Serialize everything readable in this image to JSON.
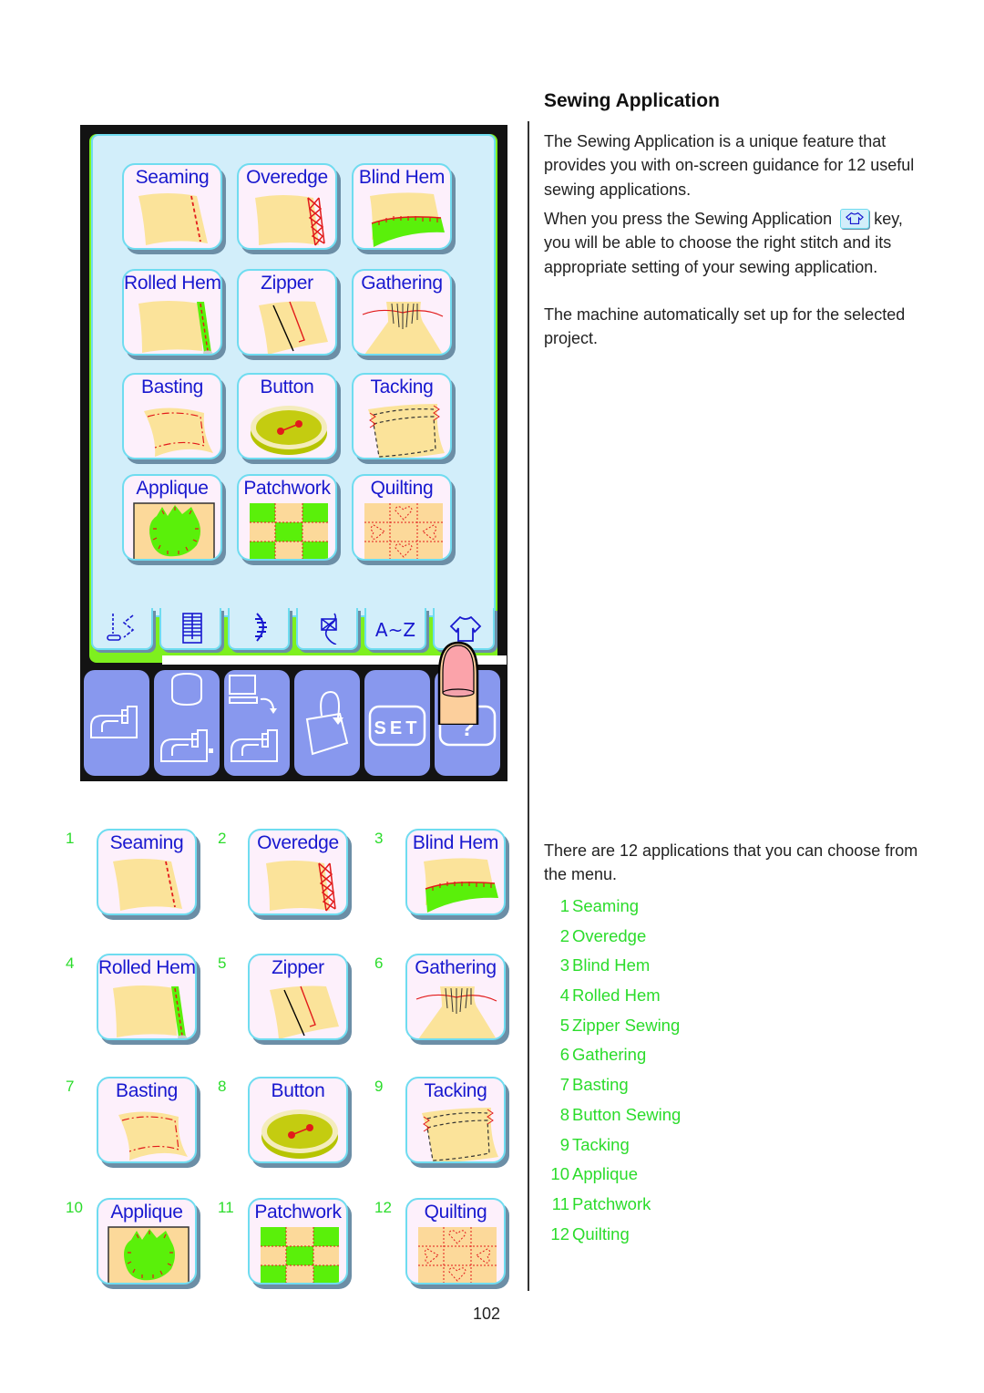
{
  "screen": {
    "tiles": [
      {
        "id": "seaming",
        "label": "Seaming"
      },
      {
        "id": "overedge",
        "label": "Overedge"
      },
      {
        "id": "blind-hem",
        "label": "Blind Hem"
      },
      {
        "id": "rolled-hem",
        "label": "Rolled Hem"
      },
      {
        "id": "zipper",
        "label": "Zipper"
      },
      {
        "id": "gathering",
        "label": "Gathering"
      },
      {
        "id": "basting",
        "label": "Basting"
      },
      {
        "id": "button",
        "label": "Button"
      },
      {
        "id": "tacking",
        "label": "Tacking"
      },
      {
        "id": "applique",
        "label": "Applique"
      },
      {
        "id": "patchwork",
        "label": "Patchwork"
      },
      {
        "id": "quilting",
        "label": "Quilting"
      }
    ],
    "tabs": [
      {
        "icon": "utility-stitch-icon"
      },
      {
        "icon": "buttonhole-icon"
      },
      {
        "icon": "decorative-stitch-icon"
      },
      {
        "icon": "cross-stitch-icon"
      },
      {
        "icon": "alphabet-icon",
        "label": "A~Z"
      },
      {
        "icon": "sewing-application-icon"
      }
    ],
    "keys": [
      {
        "icon": "sewing-machine-icon"
      },
      {
        "icon": "embroidery-unit-icon"
      },
      {
        "icon": "pc-connection-icon"
      },
      {
        "icon": "memory-folder-icon"
      },
      {
        "icon": "set-icon",
        "label": "SET"
      },
      {
        "icon": "help-icon",
        "label": "?"
      }
    ]
  },
  "article": {
    "title": "Sewing Application",
    "intro": "The Sewing Application is a unique feature that provides you with on-screen guidance for 12 useful sewing applications.",
    "press_before": "When you press the Sewing Application",
    "press_after": "key, you will be able to choose the right stitch and its appropriate setting of your sewing application.",
    "auto_setup": "The machine automatically set up for the selected project.",
    "choose": "There are 12 applications that you can choose from the menu.",
    "applications": [
      {
        "num": "1",
        "name": "Seaming"
      },
      {
        "num": "2",
        "name": "Overedge"
      },
      {
        "num": "3",
        "name": "Blind Hem"
      },
      {
        "num": "4",
        "name": "Rolled Hem"
      },
      {
        "num": "5",
        "name": "Zipper Sewing"
      },
      {
        "num": "6",
        "name": "Gathering"
      },
      {
        "num": "7",
        "name": "Basting"
      },
      {
        "num": "8",
        "name": "Button Sewing"
      },
      {
        "num": "9",
        "name": "Tacking"
      },
      {
        "num": "10",
        "name": "Applique"
      },
      {
        "num": "11",
        "name": "Patchwork"
      },
      {
        "num": "12",
        "name": "Quilting"
      }
    ]
  },
  "grid": {
    "items": [
      {
        "num": "1",
        "label": "Seaming"
      },
      {
        "num": "2",
        "label": "Overedge"
      },
      {
        "num": "3",
        "label": "Blind Hem"
      },
      {
        "num": "4",
        "label": "Rolled Hem"
      },
      {
        "num": "5",
        "label": "Zipper"
      },
      {
        "num": "6",
        "label": "Gathering"
      },
      {
        "num": "7",
        "label": "Basting"
      },
      {
        "num": "8",
        "label": "Button"
      },
      {
        "num": "9",
        "label": "Tacking"
      },
      {
        "num": "10",
        "label": "Applique"
      },
      {
        "num": "11",
        "label": "Patchwork"
      },
      {
        "num": "12",
        "label": "Quilting"
      }
    ]
  },
  "colors": {
    "label_blue": "#1818cf",
    "list_green": "#2bdc2b",
    "screen_bg": "#d2eefa",
    "key_blue": "#8898ee",
    "fabric": "#fbe39a"
  },
  "page_number": "102"
}
